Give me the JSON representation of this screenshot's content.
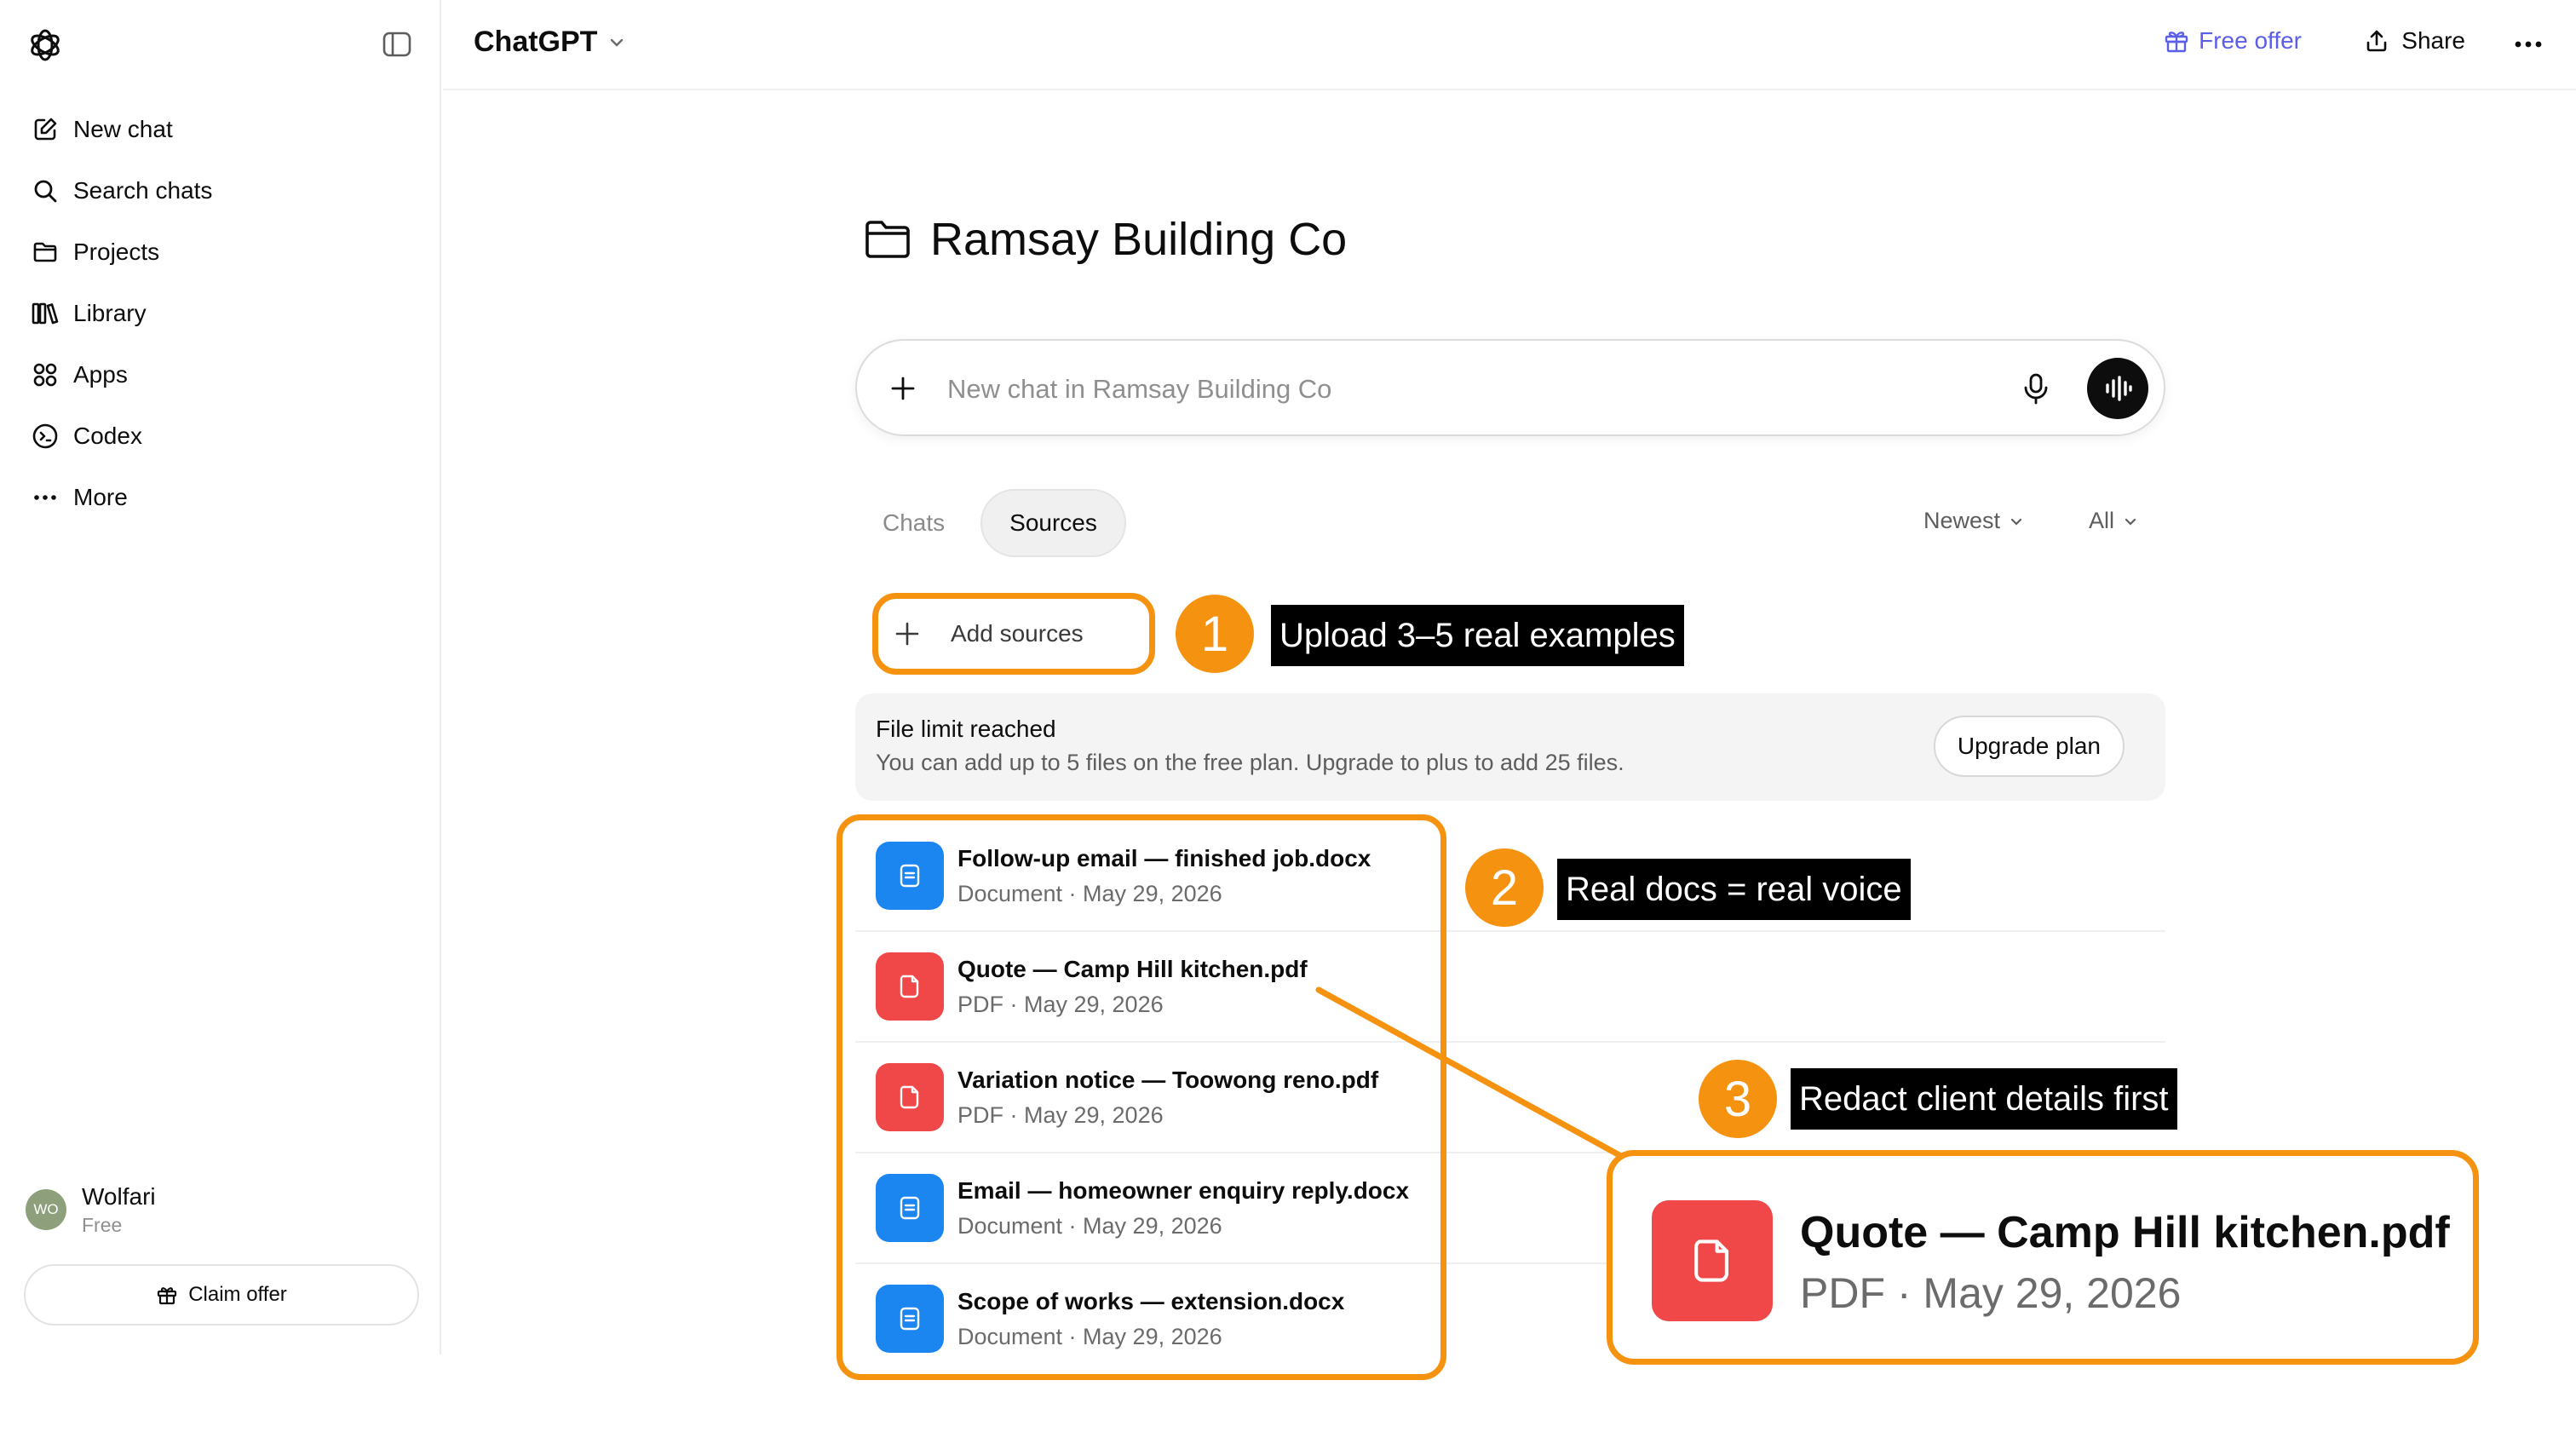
{
  "sidebar": {
    "items": [
      {
        "label": "New chat",
        "icon": "new-chat-icon"
      },
      {
        "label": "Search chats",
        "icon": "search-icon"
      },
      {
        "label": "Projects",
        "icon": "folder-icon"
      },
      {
        "label": "Library",
        "icon": "library-icon"
      },
      {
        "label": "Apps",
        "icon": "apps-icon"
      },
      {
        "label": "Codex",
        "icon": "codex-icon"
      },
      {
        "label": "More",
        "icon": "more-dots-icon"
      }
    ],
    "user": {
      "initials": "WO",
      "name": "Wolfari",
      "plan": "Free"
    },
    "claim_label": "Claim offer"
  },
  "header": {
    "model": "ChatGPT",
    "free_offer": "Free offer",
    "share": "Share"
  },
  "project": {
    "title": "Ramsay Building Co"
  },
  "composer": {
    "placeholder": "New chat in Ramsay Building Co"
  },
  "tabs": {
    "chats": "Chats",
    "sources": "Sources",
    "active": "Sources"
  },
  "filters": {
    "sort": "Newest",
    "type": "All"
  },
  "add_sources": "Add sources",
  "limit": {
    "title": "File limit reached",
    "description": "You can add up to 5 files on the free plan. Upgrade to plus to add 25 files.",
    "upgrade": "Upgrade plan"
  },
  "files": [
    {
      "name": "Follow-up email — finished job.docx",
      "meta": "Document · May 29, 2026",
      "kind": "doc"
    },
    {
      "name": "Quote — Camp Hill kitchen.pdf",
      "meta": "PDF · May 29, 2026",
      "kind": "pdf"
    },
    {
      "name": "Variation notice — Toowong reno.pdf",
      "meta": "PDF · May 29, 2026",
      "kind": "pdf"
    },
    {
      "name": "Email — homeowner enquiry reply.docx",
      "meta": "Document · May 29, 2026",
      "kind": "doc"
    },
    {
      "name": "Scope of works — extension.docx",
      "meta": "Document · May 29, 2026",
      "kind": "doc"
    }
  ],
  "annotations": [
    {
      "number": "1",
      "text": "Upload 3–5 real examples"
    },
    {
      "number": "2",
      "text": "Real docs = real voice"
    },
    {
      "number": "3",
      "text": "Redact client details first"
    }
  ],
  "zoom": {
    "name": "Quote — Camp Hill kitchen.pdf",
    "meta": "PDF · May 29, 2026"
  },
  "colors": {
    "accent_annotation": "#f5920f",
    "doc_icon": "#1c86f0",
    "pdf_icon": "#f04848",
    "free_offer": "#5b5ee6"
  }
}
